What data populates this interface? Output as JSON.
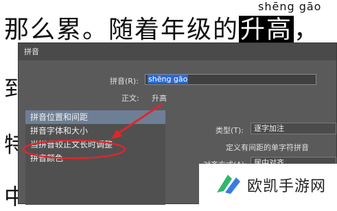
{
  "document": {
    "line1_prefix": "那么累。随着年级的",
    "line1_highlight": "升高",
    "line1_suffix": "，",
    "pinyin_above": "shēng gāo",
    "left_fragments": [
      "到",
      "特",
      "中"
    ]
  },
  "dialog": {
    "title": "拼音",
    "pinyin_label": "拼音(R):",
    "pinyin_value": "shēng gāo",
    "base_text_label": "正文:",
    "base_text_value": "升高",
    "sidebar": {
      "items": [
        {
          "label": "拼音位置和间距"
        },
        {
          "label": "拼音字体和大小"
        },
        {
          "label": "当拼音较正文长时调整"
        },
        {
          "label": "拼音颜色"
        }
      ]
    },
    "settings": {
      "type_label": "类型(T):",
      "type_value": "逐字加注",
      "type_description": "定义有间距的单字符拼音",
      "align_label": "对齐方式(A):",
      "align_value": "居中对齐"
    }
  },
  "annotation_color": "#e0262b",
  "watermark": {
    "text": "欧凯手游网",
    "logo_color": "#2fb86e",
    "logo_accent": "#3b7be0"
  }
}
